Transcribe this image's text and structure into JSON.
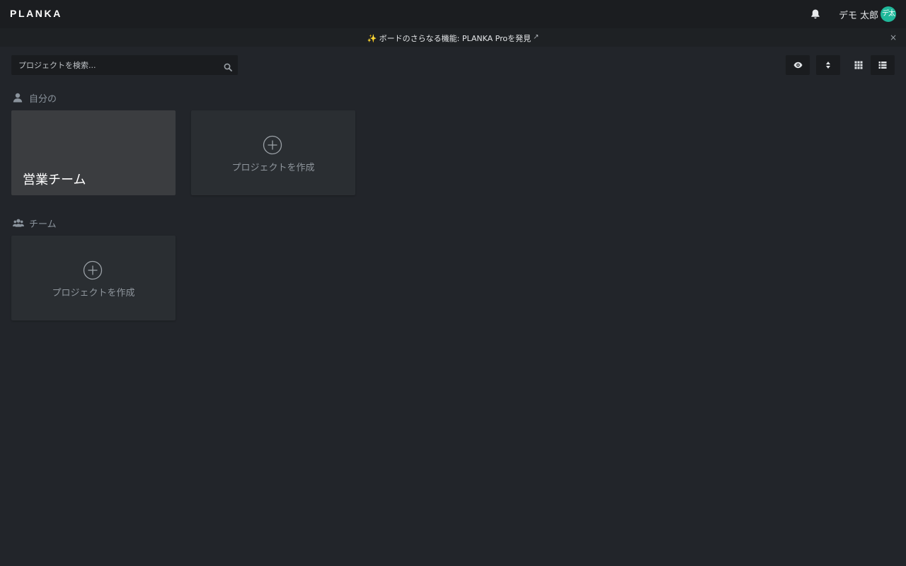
{
  "header": {
    "logo": "PLANKA",
    "user_name": "デモ 太郎",
    "avatar_initials": "デ太",
    "avatar_color": "#1fb89a"
  },
  "banner": {
    "text": "✨ ボードのさらなる機能: PLANKA Proを発見",
    "link_icon": "↗",
    "close": "×"
  },
  "search": {
    "placeholder": "プロジェクトを検索..."
  },
  "sections": [
    {
      "label": "自分の",
      "icon": "user-icon",
      "projects": [
        {
          "title": "営業チーム"
        }
      ],
      "create_label": "プロジェクトを作成"
    },
    {
      "label": "チーム",
      "icon": "users-icon",
      "projects": [],
      "create_label": "プロジェクトを作成"
    }
  ]
}
